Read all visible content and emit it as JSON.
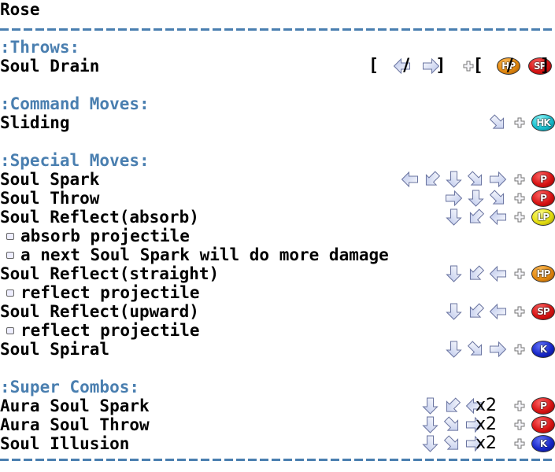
{
  "title": "Rose",
  "colors": {
    "section": "#4a7fb0",
    "dash": "#4a7fb0"
  },
  "sections": {
    "throws": {
      "label": ":Throws:",
      "moves": [
        {
          "name": "Soul Drain",
          "input_text": "[ back / forward ] + [ HP / SP ]",
          "buttons": [
            "HP",
            "SP"
          ]
        }
      ]
    },
    "command": {
      "label": ":Command Moves:",
      "moves": [
        {
          "name": "Sliding",
          "directions": [
            "down-forward"
          ],
          "button": "HK"
        }
      ]
    },
    "special": {
      "label": ":Special Moves:",
      "moves": [
        {
          "name": "Soul Spark",
          "directions": [
            "back",
            "down-back",
            "down",
            "down-forward",
            "forward"
          ],
          "button": "P"
        },
        {
          "name": "Soul Throw",
          "directions": [
            "forward",
            "down",
            "down-forward"
          ],
          "button": "P"
        },
        {
          "name": "Soul Reflect(absorb)",
          "directions": [
            "down",
            "down-back",
            "back"
          ],
          "button": "LP",
          "notes": [
            "absorb projectile",
            "a next Soul Spark will do more damage"
          ]
        },
        {
          "name": "Soul Reflect(straight)",
          "directions": [
            "down",
            "down-back",
            "back"
          ],
          "button": "HP",
          "notes": [
            "reflect projectile"
          ]
        },
        {
          "name": "Soul Reflect(upward)",
          "directions": [
            "down",
            "down-back",
            "back"
          ],
          "button": "SP",
          "notes": [
            "reflect projectile"
          ]
        },
        {
          "name": "Soul Spiral",
          "directions": [
            "down",
            "down-forward",
            "forward"
          ],
          "button": "K"
        }
      ]
    },
    "super": {
      "label": ":Super Combos:",
      "moves": [
        {
          "name": "Aura Soul Spark",
          "directions": [
            "down",
            "down-back",
            "back"
          ],
          "repeat": "x2",
          "button": "P"
        },
        {
          "name": "Aura Soul Throw",
          "directions": [
            "down",
            "down-forward",
            "forward"
          ],
          "repeat": "x2",
          "button": "P"
        },
        {
          "name": "Soul Illusion",
          "directions": [
            "down",
            "down-forward",
            "forward"
          ],
          "repeat": "x2",
          "button": "K"
        }
      ]
    }
  },
  "symbols": {
    "bracket_open": "[",
    "bracket_close": "]",
    "slash": "/"
  }
}
